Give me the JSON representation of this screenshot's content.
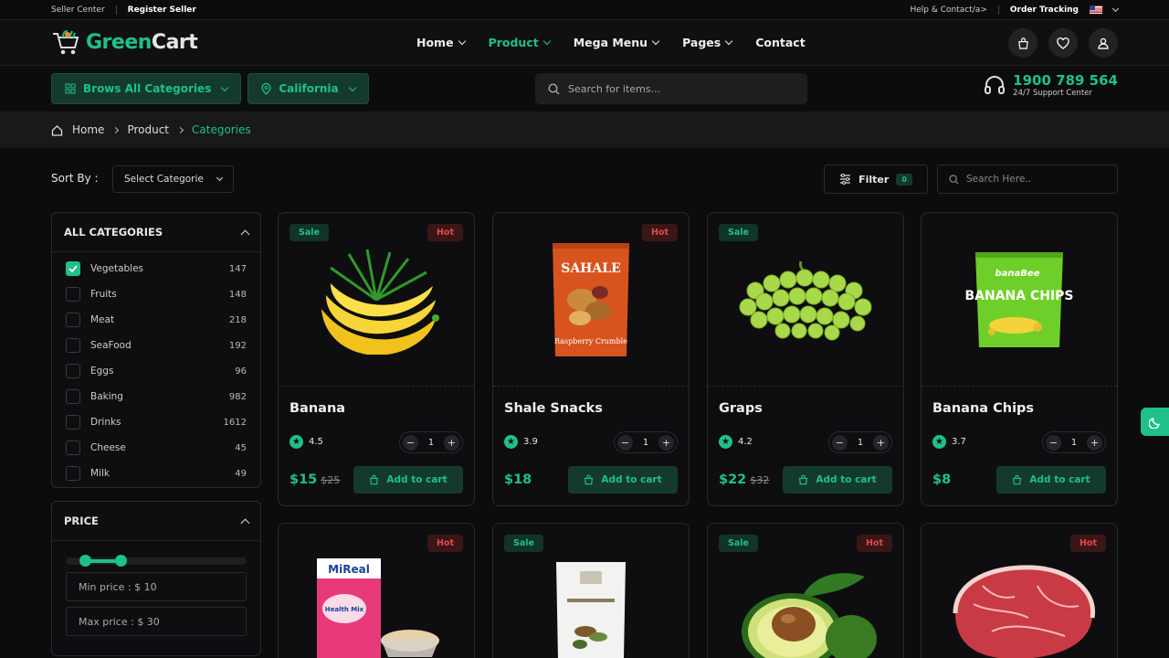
{
  "topbar": {
    "seller_center": "Seller Center",
    "register_seller": "Register Seller",
    "help": "Help & Contact/a>",
    "order_tracking": "Order Tracking"
  },
  "brand": {
    "green": "Green",
    "white": "Cart"
  },
  "nav": {
    "items": [
      {
        "label": "Home"
      },
      {
        "label": "Product",
        "active": true
      },
      {
        "label": "Mega Menu"
      },
      {
        "label": "Pages"
      },
      {
        "label": "Contact"
      }
    ]
  },
  "subnav": {
    "browse": "Brows All Categories",
    "location": "California",
    "search_placeholder": "Search for items...",
    "phone": "1900 789 564",
    "support": "24/7 Support Center"
  },
  "breadcrumb": {
    "home": "Home",
    "product": "Product",
    "current": "Categories"
  },
  "toolbar": {
    "sort_label": "Sort By :",
    "sort_value": "Select Categorie",
    "filter": "Filter",
    "filter_count": "0",
    "search_placeholder": "Search Here.."
  },
  "categories": {
    "title": "ALL CATEGORIES",
    "items": [
      {
        "name": "Vegetables",
        "count": "147",
        "checked": true
      },
      {
        "name": "Fruits",
        "count": "148"
      },
      {
        "name": "Meat",
        "count": "218"
      },
      {
        "name": "SeaFood",
        "count": "192"
      },
      {
        "name": "Eggs",
        "count": "96"
      },
      {
        "name": "Baking",
        "count": "982"
      },
      {
        "name": "Drinks",
        "count": "1612"
      },
      {
        "name": "Cheese",
        "count": "45"
      },
      {
        "name": "Milk",
        "count": "49"
      }
    ]
  },
  "price": {
    "title": "PRICE",
    "min": "Min price : $ 10",
    "max": "Max price : $ 30"
  },
  "cart_label": "Add to cart",
  "products": [
    {
      "name": "Banana",
      "rating": "4.5",
      "qty": "1",
      "price": "$15",
      "old": "$25",
      "sale": "Sale",
      "hot": "Hot"
    },
    {
      "name": "Shale Snacks",
      "rating": "3.9",
      "qty": "1",
      "price": "$18",
      "old": "",
      "sale": "",
      "hot": "Hot"
    },
    {
      "name": "Graps",
      "rating": "4.2",
      "qty": "1",
      "price": "$22",
      "old": "$32",
      "sale": "Sale",
      "hot": ""
    },
    {
      "name": "Banana Chips",
      "rating": "3.7",
      "qty": "1",
      "price": "$8",
      "old": "",
      "sale": "",
      "hot": ""
    },
    {
      "sale": "",
      "hot": "Hot"
    },
    {
      "sale": "Sale",
      "hot": ""
    },
    {
      "sale": "Sale",
      "hot": "Hot"
    },
    {
      "sale": "",
      "hot": "Hot"
    }
  ],
  "packages": {
    "sahale": "SAHALE",
    "sahale_sub": "Raspberry Crumble",
    "chips_brand": "banaBee",
    "chips_title": "BANANA CHIPS",
    "mireal": "MiReal",
    "mix": "Health Mix"
  }
}
